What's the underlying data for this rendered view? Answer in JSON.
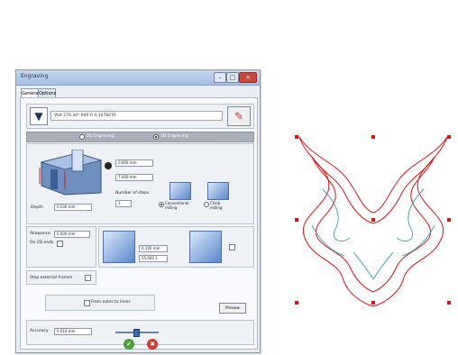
{
  "window": {
    "title": "Engraving"
  },
  "tabs": [
    {
      "label": "General"
    },
    {
      "label": "Options"
    }
  ],
  "tool": {
    "name": "Vbit 270.30° 940 R 0,1678276"
  },
  "modes": [
    {
      "label": "2D Engraving",
      "selected": false
    },
    {
      "label": "3D Engraving",
      "selected": true
    }
  ],
  "depth": {
    "label": "Depth",
    "value": "0.030 mm"
  },
  "dims": {
    "top": "0.000 mm",
    "mid": "7.000 mm"
  },
  "steps": {
    "label": "Number of steps",
    "value": "1"
  },
  "milling": [
    {
      "label": "Conventional milling",
      "selected": true
    },
    {
      "label": "Climb milling",
      "selected": false
    }
  ],
  "allowance": {
    "label": "Allowance",
    "value": "0.000 mm"
  },
  "on2d": {
    "label": "On 2D ends"
  },
  "stepExternal": {
    "label": "Stop external frames"
  },
  "side": {
    "v1": "0.100 mm",
    "v2": "55.000 1"
  },
  "fromOuter": {
    "label": "From outer to inner"
  },
  "preview": {
    "label": "Preview"
  },
  "accuracy": {
    "label": "Accuracy",
    "value": "0.010 mm"
  },
  "buttons": {
    "ok": "✔",
    "cancel": "✖"
  },
  "colors": {
    "outline": "#e01010",
    "inner": "#4aa6b5"
  }
}
